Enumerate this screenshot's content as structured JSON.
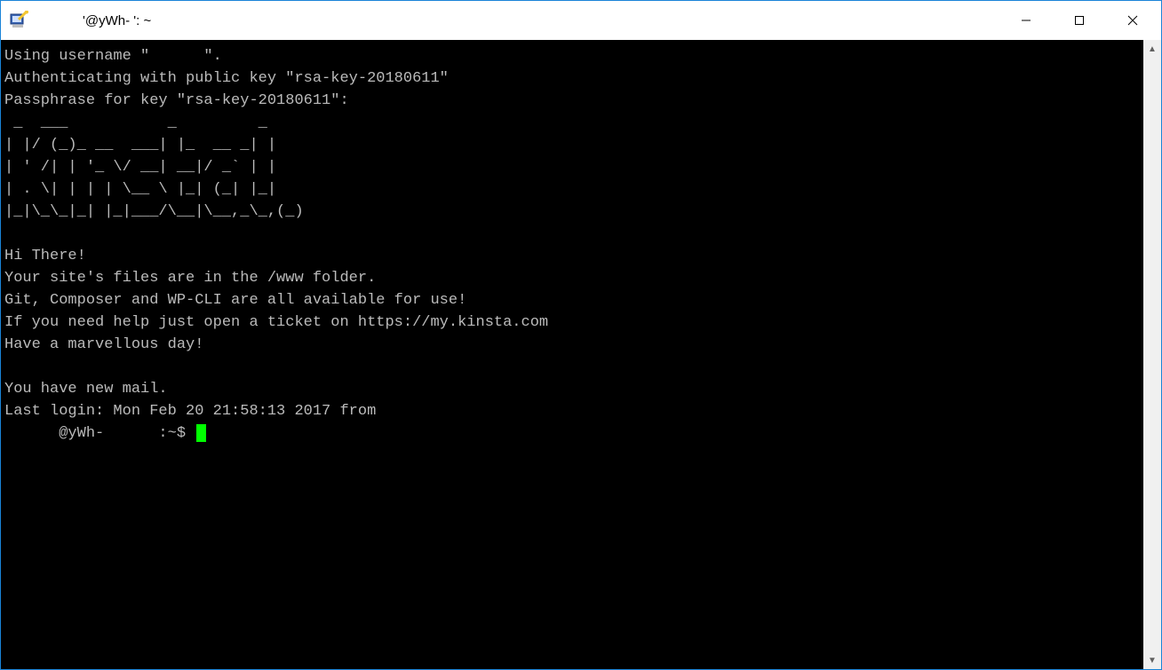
{
  "window": {
    "title": "'@yWh-      ': ~"
  },
  "terminal": {
    "lines": [
      "Using username \"      \".",
      "Authenticating with public key \"rsa-key-20180611\"",
      "Passphrase for key \"rsa-key-20180611\":",
      " _  ___           _         _",
      "| |/ (_)_ __  ___| |_  __ _| |",
      "| ' /| | '_ \\/ __| __|/ _` | |",
      "| . \\| | | | \\__ \\ |_| (_| |_|",
      "|_|\\_\\_|_| |_|___/\\__|\\__,_\\_,(_)",
      "",
      "Hi There!",
      "Your site's files are in the /www folder.",
      "Git, Composer and WP-CLI are all available for use!",
      "If you need help just open a ticket on https://my.kinsta.com",
      "Have a marvellous day!",
      "",
      "You have new mail.",
      "Last login: Mon Feb 20 21:58:13 2017 from"
    ],
    "prompt": "      @yWh-      :~$ "
  },
  "scrollbar": {
    "up": "▲",
    "down": "▼"
  }
}
